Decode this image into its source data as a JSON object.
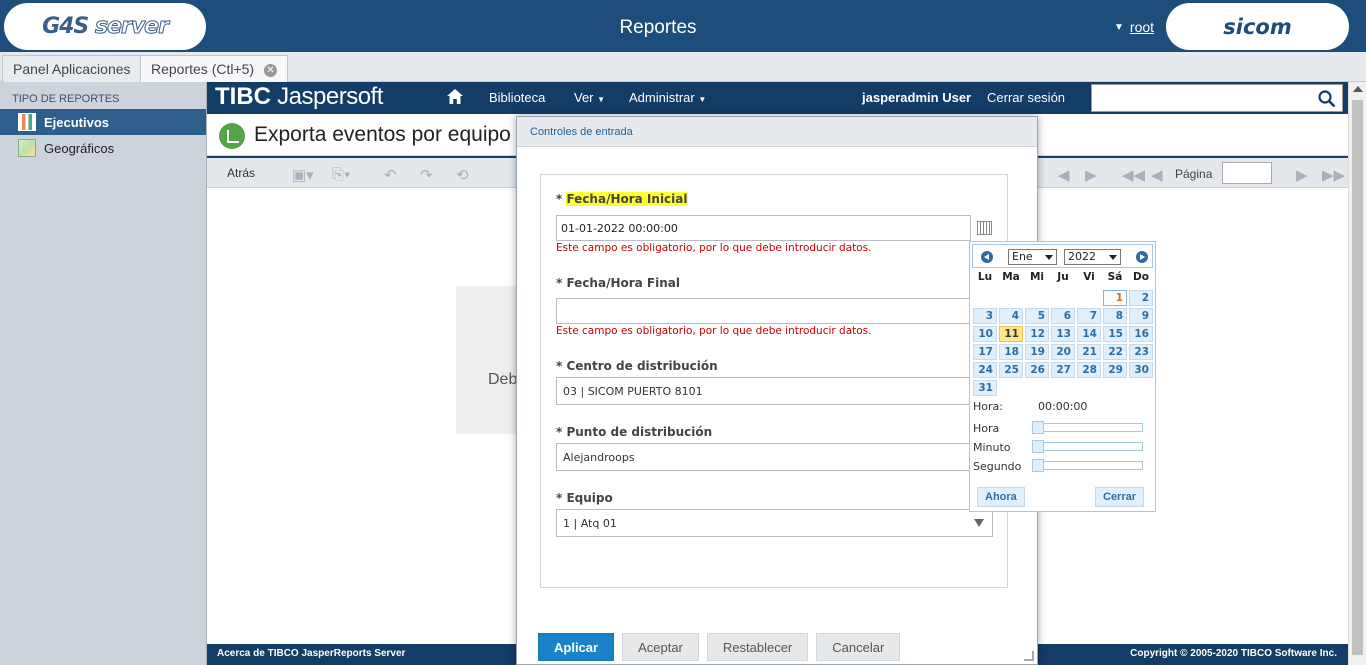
{
  "app": {
    "title": "Reportes",
    "logo_left": "G4S",
    "logo_left_suffix": "server",
    "logo_right": "sicom",
    "user": "root"
  },
  "tabs": [
    {
      "label": "Panel Aplicaciones"
    },
    {
      "label": "Reportes (Ctl+5)"
    }
  ],
  "sidebar": {
    "header": "TIPO DE REPORTES",
    "items": [
      {
        "label": "Ejecutivos",
        "active": true
      },
      {
        "label": "Geográficos",
        "active": false
      }
    ]
  },
  "jasper": {
    "logo_a": "TIBC",
    "logo_b": "Jaspersoft",
    "nav": {
      "library": "Biblioteca",
      "view": "Ver",
      "admin": "Administrar",
      "user": "jasperadmin User",
      "logout": "Cerrar sesión"
    },
    "search_value": ""
  },
  "report": {
    "title": "Exporta eventos por equipo",
    "back_label": "Atrás",
    "page_label": "Página",
    "page_value": "",
    "body_text": "Deb"
  },
  "footer": {
    "left": "Acerca de TIBCO JasperReports Server",
    "right": "Copyright © 2005-2020 TIBCO Software Inc."
  },
  "dialog": {
    "title": "Controles de entrada",
    "fields": {
      "start": {
        "label": "Fecha/Hora Inicial",
        "value": "01-01-2022 00:00:00",
        "error": "Este campo es obligatorio, por lo que debe introducir datos."
      },
      "end": {
        "label": "Fecha/Hora Final",
        "value": "",
        "error": "Este campo es obligatorio, por lo que debe introducir datos."
      },
      "center": {
        "label": "Centro de distribución",
        "value": "03 | SICOM PUERTO 8101"
      },
      "point": {
        "label": "Punto de distribución",
        "value": "Alejandroops"
      },
      "equipment": {
        "label": "Equipo",
        "value": "1 | Atq 01"
      }
    },
    "required_mark": "*",
    "buttons": {
      "apply": "Aplicar",
      "accept": "Aceptar",
      "reset": "Restablecer",
      "cancel": "Cancelar"
    }
  },
  "calendar": {
    "month": "Ene",
    "year": "2022",
    "weekdays": [
      "Lu",
      "Ma",
      "Mi",
      "Ju",
      "Vi",
      "Sá",
      "Do"
    ],
    "days": [
      "1",
      "2",
      "3",
      "4",
      "5",
      "6",
      "7",
      "8",
      "9",
      "10",
      "11",
      "12",
      "13",
      "14",
      "15",
      "16",
      "17",
      "18",
      "19",
      "20",
      "21",
      "22",
      "23",
      "24",
      "25",
      "26",
      "27",
      "28",
      "29",
      "30",
      "31"
    ],
    "first_weekday_index": 5,
    "today": "11",
    "selected": "1",
    "time_label": "Hora:",
    "time_value": "00:00:00",
    "hour_label": "Hora",
    "minute_label": "Minuto",
    "second_label": "Segundo",
    "hour": 0,
    "minute": 0,
    "second": 0,
    "now_button": "Ahora",
    "close_button": "Cerrar"
  }
}
